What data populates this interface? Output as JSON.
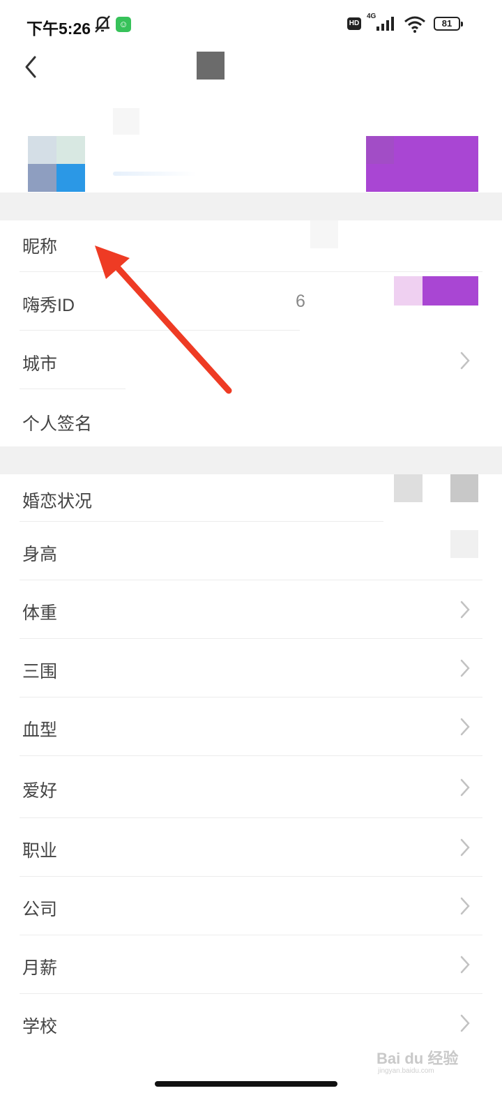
{
  "status_bar": {
    "time": "下午5:26",
    "network": "4G",
    "hd": "HD",
    "battery": "81"
  },
  "profile_items": [
    {
      "label": "昵称",
      "value_fragment": ""
    },
    {
      "label": "嗨秀ID",
      "value_fragment": "6"
    },
    {
      "label": "城市"
    },
    {
      "label": "个人签名"
    }
  ],
  "detail_items": [
    {
      "label": "婚恋状况"
    },
    {
      "label": "身高"
    },
    {
      "label": "体重"
    },
    {
      "label": "三围"
    },
    {
      "label": "血型"
    },
    {
      "label": "爱好"
    },
    {
      "label": "职业"
    },
    {
      "label": "公司"
    },
    {
      "label": "月薪"
    },
    {
      "label": "学校"
    }
  ],
  "watermark": {
    "brand": "Bai du 经验",
    "url": "jingyan.baidu.com"
  },
  "colors": {
    "accent_purple": "#a946d3",
    "annotation_arrow": "#ee3b24",
    "app_badge": "#37c25a"
  }
}
